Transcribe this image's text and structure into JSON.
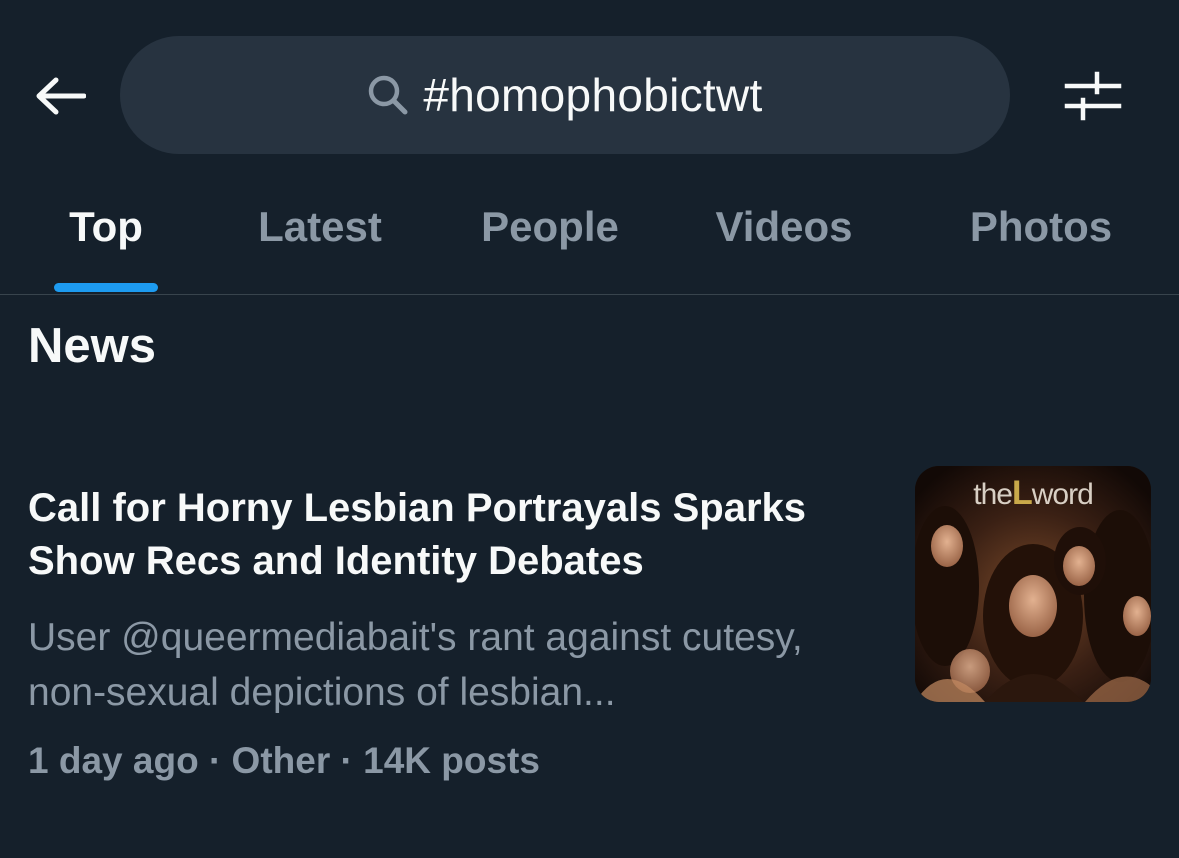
{
  "header": {
    "back_icon": "arrow-left-icon",
    "search_icon": "search-icon",
    "search_query": "#homophobictwt",
    "filter_icon": "sliders-icon"
  },
  "tabs": [
    {
      "label": "Top",
      "active": true
    },
    {
      "label": "Latest",
      "active": false
    },
    {
      "label": "People",
      "active": false
    },
    {
      "label": "Videos",
      "active": false
    },
    {
      "label": "Photos",
      "active": false
    }
  ],
  "news": {
    "section_title": "News",
    "items": [
      {
        "headline": "Call for Horny Lesbian Portrayals Sparks Show Recs and Identity Debates",
        "summary": "User @queermediabait's rant against cutesy, non-sexual depictions of lesbian...",
        "meta": "1 day ago · Other · 14K posts",
        "thumbnail": {
          "caption_pre": "the",
          "caption_letter": "L",
          "caption_post": "word"
        }
      }
    ]
  },
  "colors": {
    "background": "#15202b",
    "search_bg": "#273340",
    "accent": "#1d9bf0",
    "text_primary": "#f7f9f9",
    "text_secondary": "#8b98a5",
    "divider": "#38444d"
  }
}
